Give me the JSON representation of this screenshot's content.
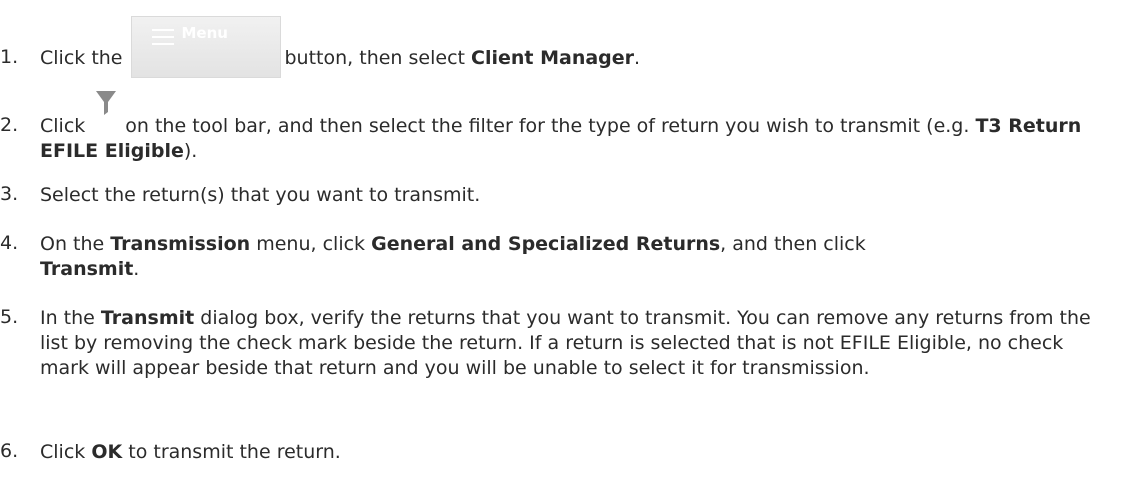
{
  "steps": [
    {
      "number": "1.",
      "pre": "Click the",
      "menu_button_label": "Menu",
      "mid": "button, then select",
      "bold1": "Client Manager",
      "post": "."
    },
    {
      "number": "2.",
      "pre": "Click",
      "filter_icon": "filter-funnel-icon",
      "mid": "on the tool bar, and then select the filter for the type of return you wish to transmit (e.g.",
      "bold1": "T3 Return EFILE Eligible",
      "post": ")."
    },
    {
      "number": "3.",
      "text": "Select the return(s) that you want to transmit."
    },
    {
      "number": "4.",
      "pre": "On the",
      "bold1": "Transmission",
      "mid": "menu, click",
      "bold2": "General and Specialized Returns",
      "mid2": ", and then click",
      "bold3": "Transmit",
      "post": "."
    },
    {
      "number": "5.",
      "pre": "In the",
      "bold1": "Transmit",
      "post": "dialog box, verify the returns that you want to transmit. You can remove any returns from the list by removing the check mark beside the return. If a return is selected that is not EFILE Eligible, no check mark will appear beside that return and you will be unable to select it for transmission."
    },
    {
      "number": "6.",
      "pre": "Click",
      "bold1": "OK",
      "post": "to transmit the return."
    }
  ],
  "colors": {
    "text": "#2b2b2b",
    "menu_button_bg": "#e6e6e6",
    "filter_icon": "#8a8a8a"
  }
}
